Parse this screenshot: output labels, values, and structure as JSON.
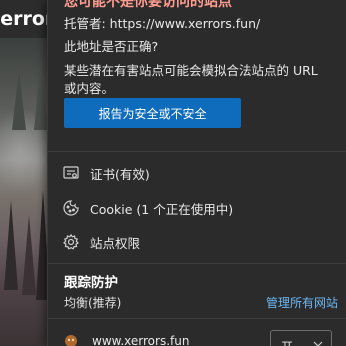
{
  "background": {
    "heading": "xerrors"
  },
  "flyout": {
    "warning_title": "您可能不是你要访问的站点",
    "host": "托管者: https://www.xerrors.fun/",
    "question": "此地址是否正确?",
    "explanation": "某些潜在有害站点可能会模拟合法站点的 URL 或内容。",
    "report_button": "报告为安全或不安全",
    "items": [
      {
        "label": "证书(有效)",
        "icon": "certificate-icon"
      },
      {
        "label": "Cookie (1 个正在使用中)",
        "icon": "cookie-icon"
      },
      {
        "label": "站点权限",
        "icon": "gear-icon"
      }
    ],
    "tracking": {
      "title": "跟踪防护",
      "level": "均衡(推荐)",
      "manage_link": "管理所有网站",
      "site": "www.xerrors.fun",
      "toggle_value": "开"
    }
  },
  "colors": {
    "flyout_bg": "#2b2b2b",
    "accent": "#0f6cbd",
    "link": "#6cb8f6",
    "warning": "#ff9c8f"
  }
}
